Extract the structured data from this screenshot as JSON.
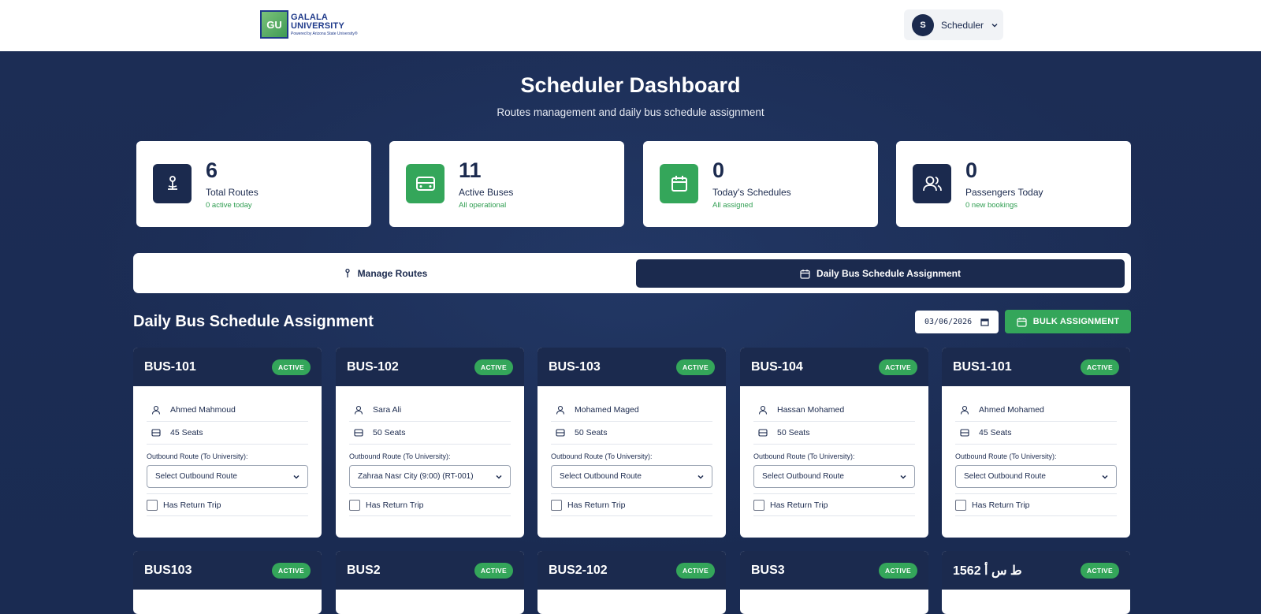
{
  "header": {
    "logo": {
      "line1": "GALALA",
      "line2": "UNIVERSITY",
      "line3": "Powered by Arizona State University®",
      "mark": "GU"
    },
    "user": {
      "initial": "S",
      "role": "Scheduler"
    }
  },
  "page": {
    "title": "Scheduler Dashboard",
    "subtitle": "Routes management and daily bus schedule assignment"
  },
  "stats": [
    {
      "value": "6",
      "label": "Total Routes",
      "sub": "0 active today",
      "icon": "route-pin-icon"
    },
    {
      "value": "11",
      "label": "Active Buses",
      "sub": "All operational",
      "icon": "bus-icon"
    },
    {
      "value": "0",
      "label": "Today's Schedules",
      "sub": "All assigned",
      "icon": "calendar-icon"
    },
    {
      "value": "0",
      "label": "Passengers Today",
      "sub": "0 new bookings",
      "icon": "users-icon"
    }
  ],
  "tabs": [
    {
      "label": "Manage Routes",
      "active": false
    },
    {
      "label": "Daily Bus Schedule Assignment",
      "active": true
    }
  ],
  "schedule": {
    "title": "Daily Bus Schedule Assignment",
    "date": "03/06/2026",
    "bulk_label": "BULK ASSIGNMENT",
    "outbound_label": "Outbound Route (To University):",
    "return_label": "Has Return Trip"
  },
  "buses": [
    {
      "name": "BUS-101",
      "status": "ACTIVE",
      "driver": "Ahmed Mahmoud",
      "seats": "45 Seats",
      "route": "Select Outbound Route"
    },
    {
      "name": "BUS-102",
      "status": "ACTIVE",
      "driver": "Sara Ali",
      "seats": "50 Seats",
      "route": "Zahraa Nasr City (9:00) (RT-001)"
    },
    {
      "name": "BUS-103",
      "status": "ACTIVE",
      "driver": "Mohamed Maged",
      "seats": "50 Seats",
      "route": "Select Outbound Route"
    },
    {
      "name": "BUS-104",
      "status": "ACTIVE",
      "driver": "Hassan Mohamed",
      "seats": "50 Seats",
      "route": "Select Outbound Route"
    },
    {
      "name": "BUS1-101",
      "status": "ACTIVE",
      "driver": "Ahmed Mohamed",
      "seats": "45 Seats",
      "route": "Select Outbound Route"
    },
    {
      "name": "BUS103",
      "status": "ACTIVE"
    },
    {
      "name": "BUS2",
      "status": "ACTIVE"
    },
    {
      "name": "BUS2-102",
      "status": "ACTIVE"
    },
    {
      "name": "BUS3",
      "status": "ACTIVE"
    },
    {
      "name": "1562 ط س أ",
      "status": "ACTIVE"
    }
  ],
  "colors": {
    "navy": "#1b2a4e",
    "green": "#34a65a",
    "background": "#1a2b52"
  }
}
